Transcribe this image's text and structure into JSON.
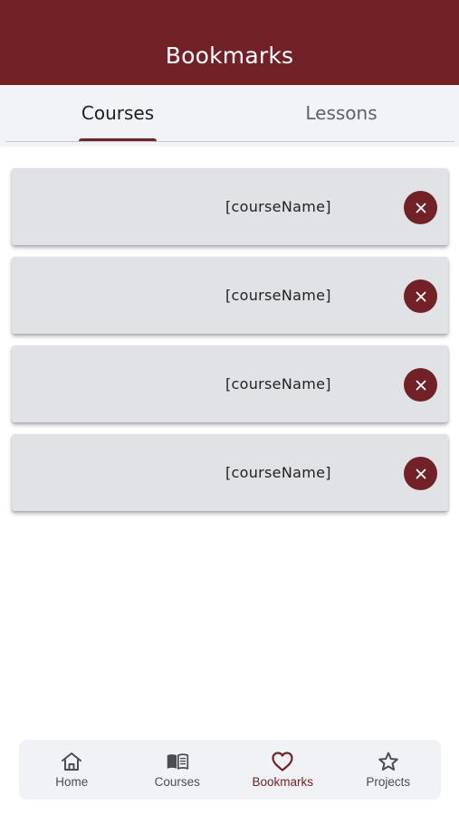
{
  "app_bar": {
    "title": "Bookmarks"
  },
  "tabs": [
    {
      "label": "Courses",
      "selected": true
    },
    {
      "label": "Lessons",
      "selected": false
    }
  ],
  "bookmarks": [
    {
      "name": "[courseName]"
    },
    {
      "name": "[courseName]"
    },
    {
      "name": "[courseName]"
    },
    {
      "name": "[courseName]"
    }
  ],
  "bottom_nav": [
    {
      "label": "Home",
      "icon": "home-icon",
      "active": false
    },
    {
      "label": "Courses",
      "icon": "book-icon",
      "active": false
    },
    {
      "label": "Bookmarks",
      "icon": "heart-icon",
      "active": true
    },
    {
      "label": "Projects",
      "icon": "star-icon",
      "active": false
    }
  ],
  "colors": {
    "brand": "#722227",
    "surface": "#f1f3f6",
    "card": "#e1e2e5"
  }
}
